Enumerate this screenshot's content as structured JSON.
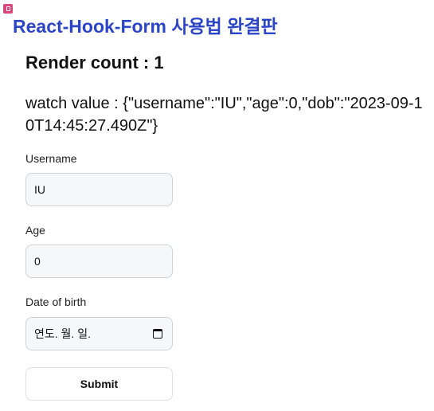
{
  "header": {
    "title": "React-Hook-Form 사용법 완결판",
    "corner_icon": "clipboard-icon",
    "corner_icon_color": "#d9467a",
    "title_color": "#2b45c9"
  },
  "status": {
    "render_count": "Render count : 1",
    "watch_value": "watch value : {\"username\":\"IU\",\"age\":0,\"dob\":\"2023-09-10T14:45:27.490Z\"}"
  },
  "form": {
    "username": {
      "label": "Username",
      "value": "IU"
    },
    "age": {
      "label": "Age",
      "value": "0"
    },
    "dob": {
      "label": "Date of birth",
      "placeholder": "연도. 월. 일.",
      "icon": "calendar-icon"
    },
    "submit_label": "Submit"
  }
}
